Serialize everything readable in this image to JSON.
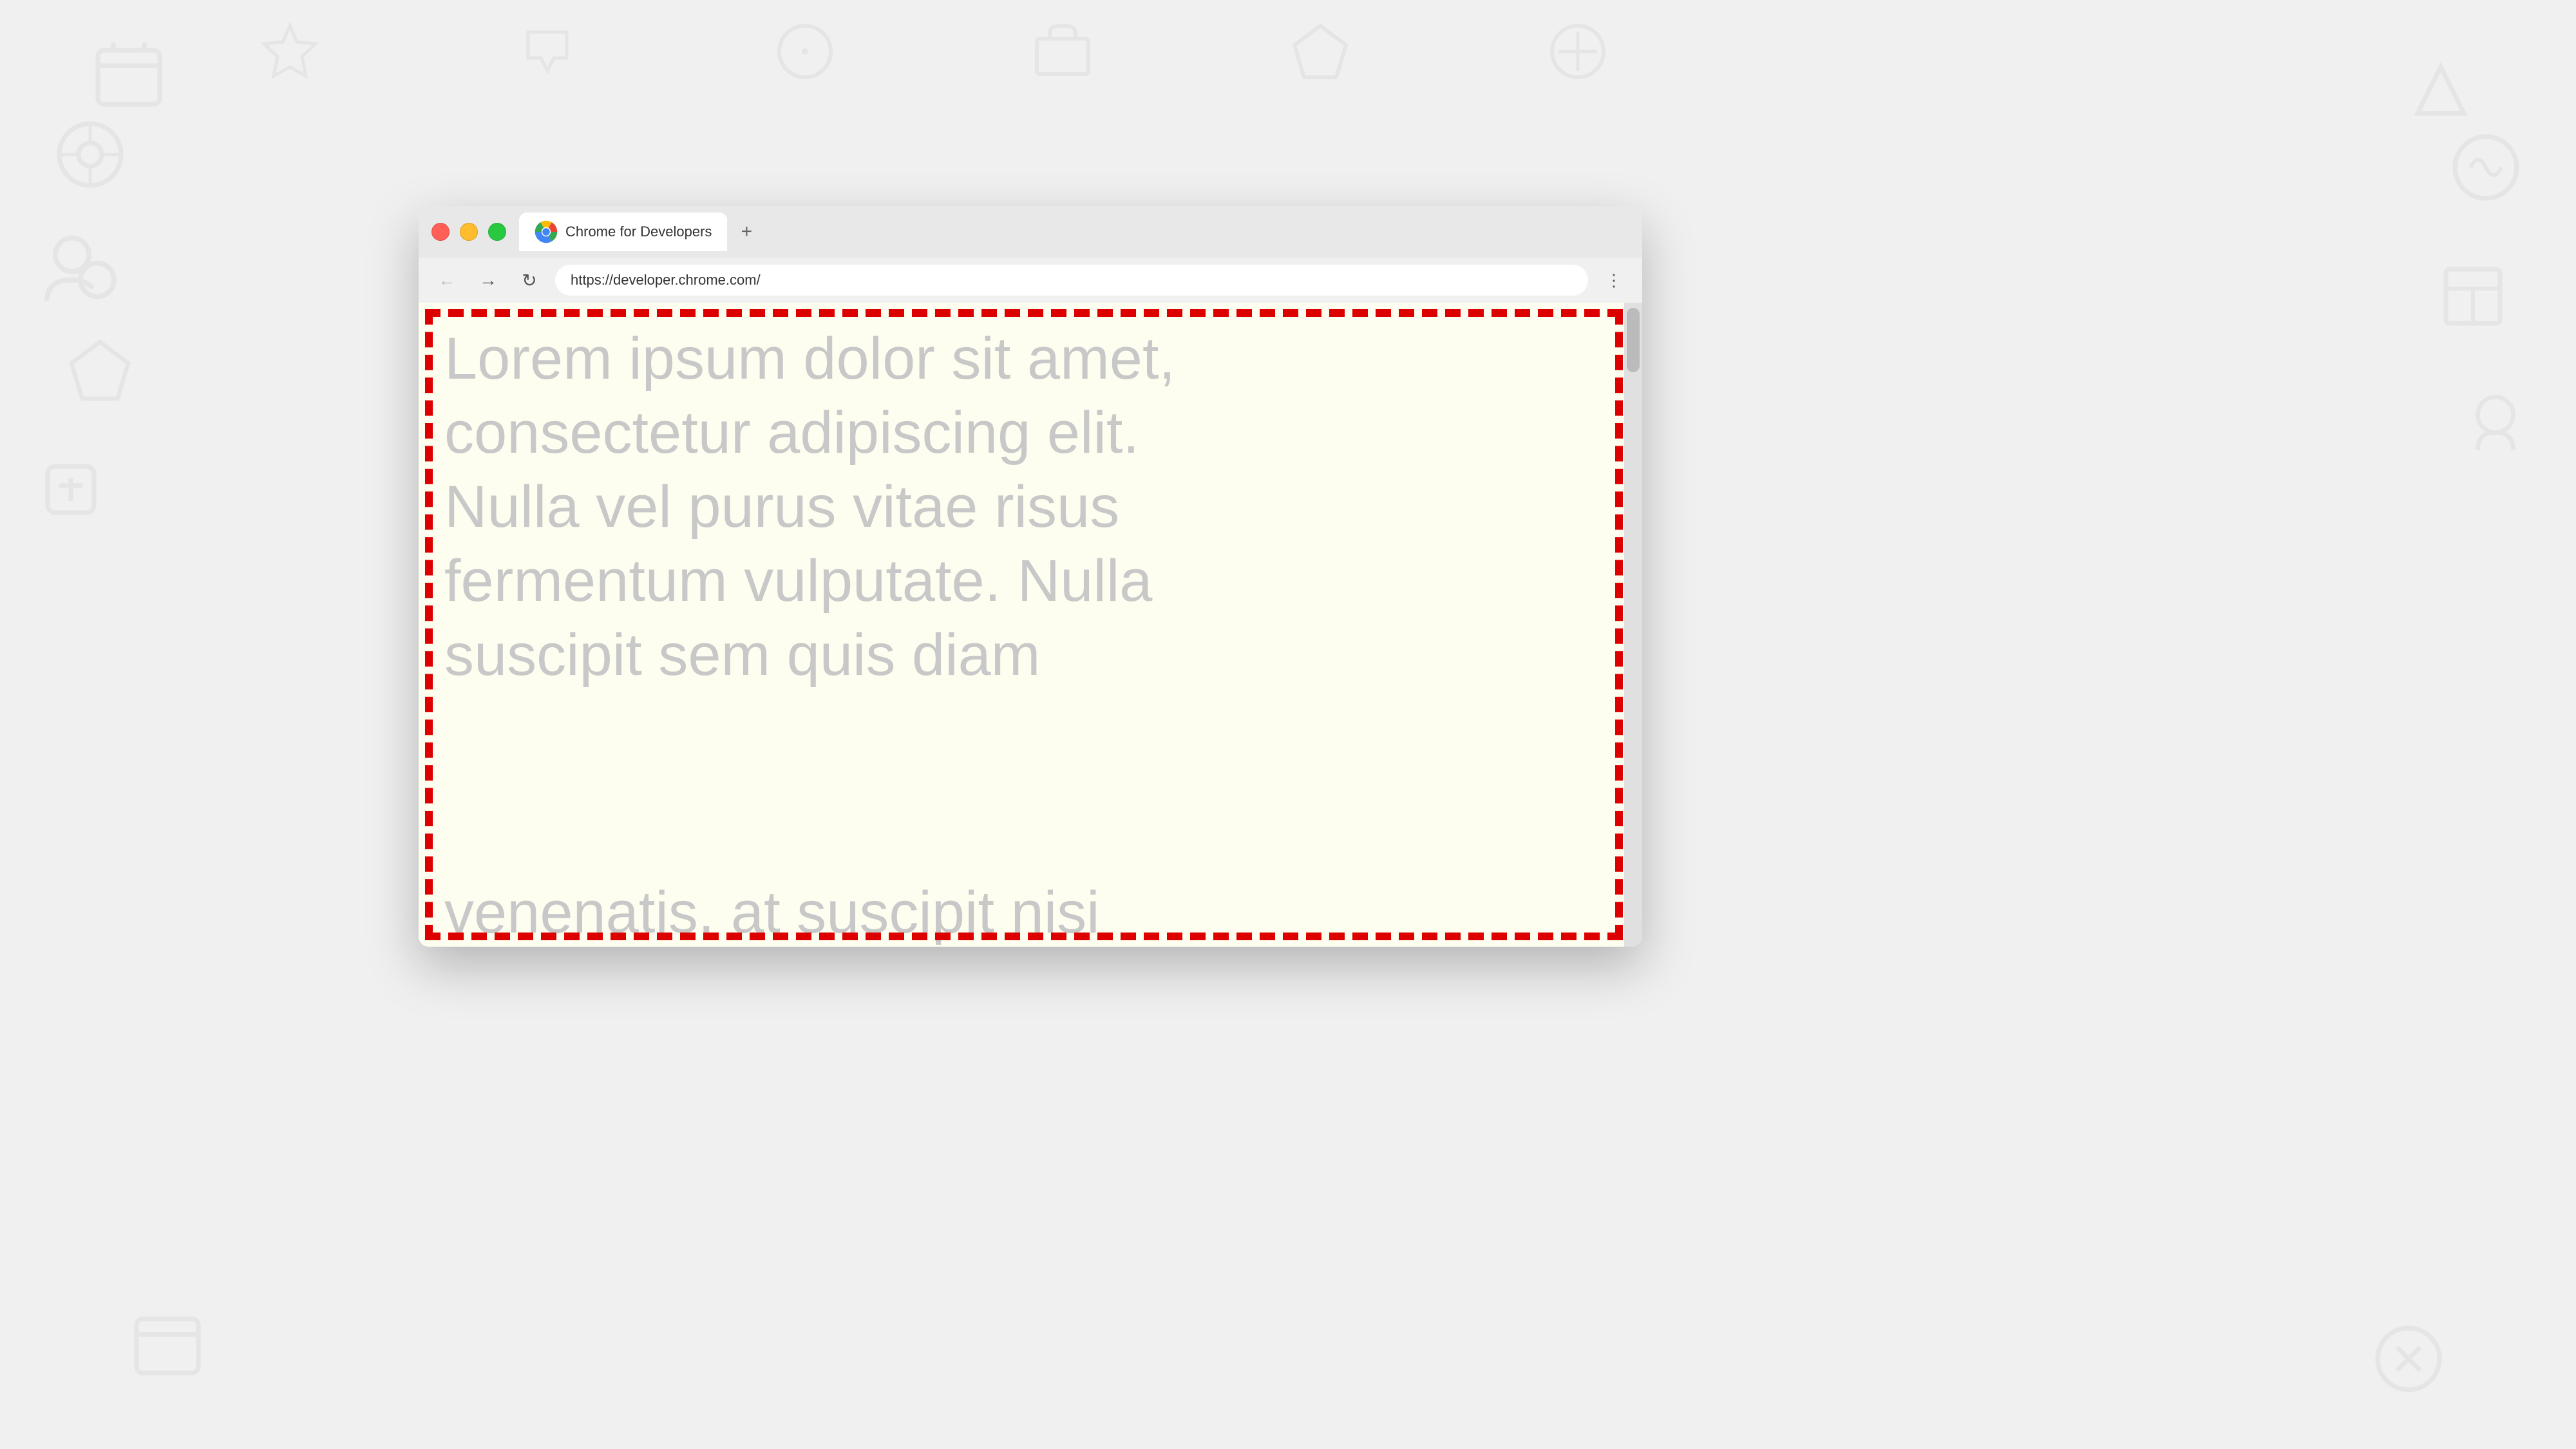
{
  "background": {
    "color": "#f0f0f0"
  },
  "browser": {
    "title_bar": {
      "traffic_lights": {
        "red": "#ff5f57",
        "yellow": "#febc2e",
        "green": "#28c840"
      }
    },
    "tab": {
      "title": "Chrome for Developers",
      "new_tab_label": "+"
    },
    "nav": {
      "back_label": "←",
      "forward_label": "→",
      "refresh_label": "↻",
      "url": "https://developer.chrome.com/",
      "menu_label": "⋮"
    },
    "page": {
      "lorem_text": "Lorem ipsum dolor sit amet, consectetur adipiscing elit. Nulla vel purus vitae risus fermentum vulputate. Nulla suscipit sem quis diam venenatis, at suscipit nisi eleifend. Nulla pretium eget",
      "background_color": "#fefef0",
      "text_color": "#c8c8c8",
      "border_color": "#dd0000"
    }
  }
}
